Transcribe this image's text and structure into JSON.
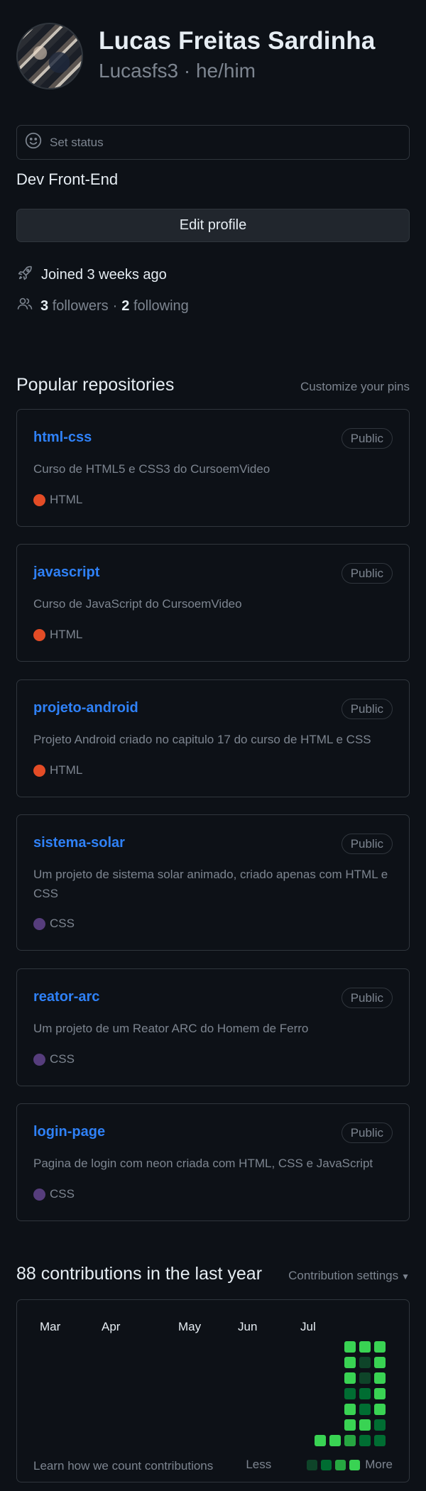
{
  "profile": {
    "full_name": "Lucas Freitas Sardinha",
    "login_line": "Lucasfs3 · he/him",
    "status_placeholder": "Set status",
    "bio": "Dev Front-End",
    "edit_label": "Edit profile",
    "joined": "Joined 3 weeks ago",
    "followers_count": "3",
    "followers_label": "followers",
    "separator": "·",
    "following_count": "2",
    "following_label": "following"
  },
  "popular": {
    "title": "Popular repositories",
    "customize": "Customize your pins",
    "repos": [
      {
        "name": "html-css",
        "visibility": "Public",
        "description": "Curso de HTML5 e CSS3 do CursoemVideo",
        "language": "HTML",
        "lang_color": "#e34c26"
      },
      {
        "name": "javascript",
        "visibility": "Public",
        "description": "Curso de JavaScript do CursoemVideo",
        "language": "HTML",
        "lang_color": "#e34c26"
      },
      {
        "name": "projeto-android",
        "visibility": "Public",
        "description": "Projeto Android criado no capitulo 17 do curso de HTML e CSS",
        "language": "HTML",
        "lang_color": "#e34c26"
      },
      {
        "name": "sistema-solar",
        "visibility": "Public",
        "description": "Um projeto de sistema solar animado, criado apenas com HTML e CSS",
        "language": "CSS",
        "lang_color": "#563d7c"
      },
      {
        "name": "reator-arc",
        "visibility": "Public",
        "description": "Um projeto de um Reator ARC do Homem de Ferro",
        "language": "CSS",
        "lang_color": "#563d7c"
      },
      {
        "name": "login-page",
        "visibility": "Public",
        "description": "Pagina de login com neon criada com HTML, CSS e JavaScript",
        "language": "CSS",
        "lang_color": "#563d7c"
      }
    ]
  },
  "contributions": {
    "title": "88 contributions in the last year",
    "settings_label": "Contribution settings",
    "months": [
      "Mar",
      "Apr",
      "May",
      "Jun",
      "Jul"
    ],
    "learn": "Learn how we count contributions",
    "legend_less": "Less",
    "legend_more": "More",
    "colors": [
      "#0e4429",
      "#006d32",
      "#26a641",
      "#39d353"
    ],
    "weeks": [
      {
        "days": [
          null,
          null,
          null,
          null,
          null,
          null,
          3
        ]
      },
      {
        "days": [
          null,
          null,
          null,
          null,
          null,
          null,
          3
        ]
      },
      {
        "days": [
          3,
          3,
          3,
          1,
          3,
          3,
          2
        ]
      },
      {
        "days": [
          3,
          0,
          0,
          1,
          1,
          3,
          1
        ]
      },
      {
        "days": [
          3,
          3,
          3,
          3,
          3,
          1,
          1
        ]
      }
    ]
  },
  "colors": {
    "background": "#0d1117",
    "border": "#30363d",
    "link": "#2f81f7",
    "muted": "#7d8590",
    "text": "#e6edf3"
  }
}
